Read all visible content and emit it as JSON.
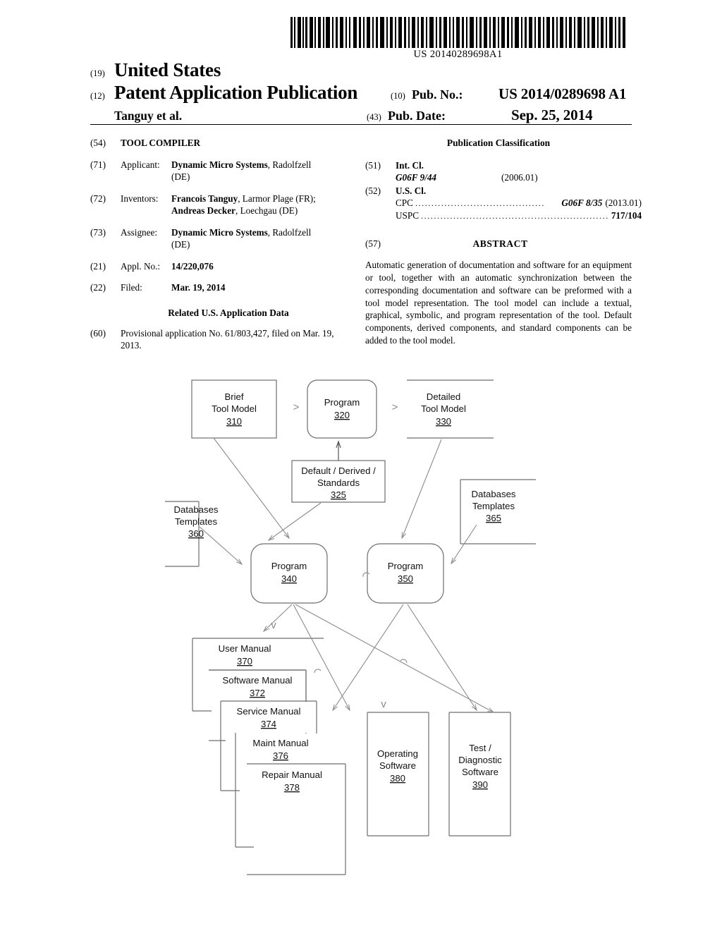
{
  "header": {
    "barcode_number": "US 20140289698A1",
    "country_code": "(19)",
    "country": "United States",
    "doc_code": "(12)",
    "doc_type": "Patent Application Publication",
    "authors": "Tanguy et al.",
    "pubno_code": "(10)",
    "pubno_label": "Pub. No.:",
    "pubno_value": "US 2014/0289698 A1",
    "pubdate_code": "(43)",
    "pubdate_label": "Pub. Date:",
    "pubdate_value": "Sep. 25, 2014"
  },
  "left_column": {
    "title_code": "(54)",
    "title": "TOOL COMPILER",
    "applicant_code": "(71)",
    "applicant_label": "Applicant:",
    "applicant_name": "Dynamic Micro Systems",
    "applicant_rest": ", Radolfzell",
    "applicant_line2": "(DE)",
    "inventors_code": "(72)",
    "inventors_label": "Inventors:",
    "inventor1_name": "Francois Tanguy",
    "inventor1_rest": ", Larmor Plage (FR);",
    "inventor2_name": "Andreas Decker",
    "inventor2_rest": ", Loechgau (DE)",
    "assignee_code": "(73)",
    "assignee_label": "Assignee:",
    "assignee_name": "Dynamic Micro Systems",
    "assignee_rest": ", Radolfzell",
    "assignee_line2": "(DE)",
    "applno_code": "(21)",
    "applno_label": "Appl. No.:",
    "applno_value": "14/220,076",
    "filed_code": "(22)",
    "filed_label": "Filed:",
    "filed_value": "Mar. 19, 2014",
    "related_title": "Related U.S. Application Data",
    "related_code": "(60)",
    "related_text": "Provisional application No. 61/803,427, filed on Mar. 19, 2013."
  },
  "right_column": {
    "classification_title": "Publication Classification",
    "intcl_code": "(51)",
    "intcl_label": "Int. Cl.",
    "intcl_value": "G06F 9/44",
    "intcl_edition": "(2006.01)",
    "uscl_code": "(52)",
    "uscl_label": "U.S. Cl.",
    "cpc_name": "CPC",
    "cpc_dots": "........................................",
    "cpc_value": "G06F 8/35",
    "cpc_edition": "(2013.01)",
    "uspc_name": "USPC",
    "uspc_dots": "..........................................................",
    "uspc_value": "717/104",
    "abstract_code": "(57)",
    "abstract_heading": "ABSTRACT",
    "abstract_text": "Automatic generation of documentation and software for an equipment or tool, together with an automatic synchronization between the corresponding documentation and software can be preformed with a tool model representation. The tool model can include a textual, graphical, symbolic, and program representation of the tool. Default components, derived components, and standard components can be added to the tool model."
  },
  "diagram": {
    "nodes": {
      "brief_tool_model": {
        "line1": "Brief",
        "line2": "Tool Model",
        "ref": "310"
      },
      "program_320": {
        "line1": "Program",
        "ref": "320"
      },
      "detailed_tool_model": {
        "line1": "Detailed",
        "line2": "Tool Model",
        "ref": "330"
      },
      "default_derived": {
        "line1": "Default / Derived /",
        "line2": "Standards",
        "ref": "325"
      },
      "databases_360": {
        "line1": "Databases",
        "line2": "Templates",
        "ref": "360"
      },
      "databases_365": {
        "line1": "Databases",
        "line2": "Templates",
        "ref": "365"
      },
      "program_340": {
        "line1": "Program",
        "ref": "340"
      },
      "program_350": {
        "line1": "Program",
        "ref": "350"
      },
      "user_manual": {
        "line1": "User Manual",
        "ref": "370"
      },
      "software_manual": {
        "line1": "Software Manual",
        "ref": "372"
      },
      "service_manual": {
        "line1": "Service Manual",
        "ref": "374"
      },
      "maint_manual": {
        "line1": "Maint Manual",
        "ref": "376"
      },
      "repair_manual": {
        "line1": "Repair Manual",
        "ref": "378"
      },
      "operating_software": {
        "line1": "Operating",
        "line2": "Software",
        "ref": "380"
      },
      "test_diagnostic": {
        "line1": "Test /",
        "line2": "Diagnostic",
        "line3": "Software",
        "ref": "390"
      }
    },
    "connectors": {
      "chevron": ">"
    }
  }
}
